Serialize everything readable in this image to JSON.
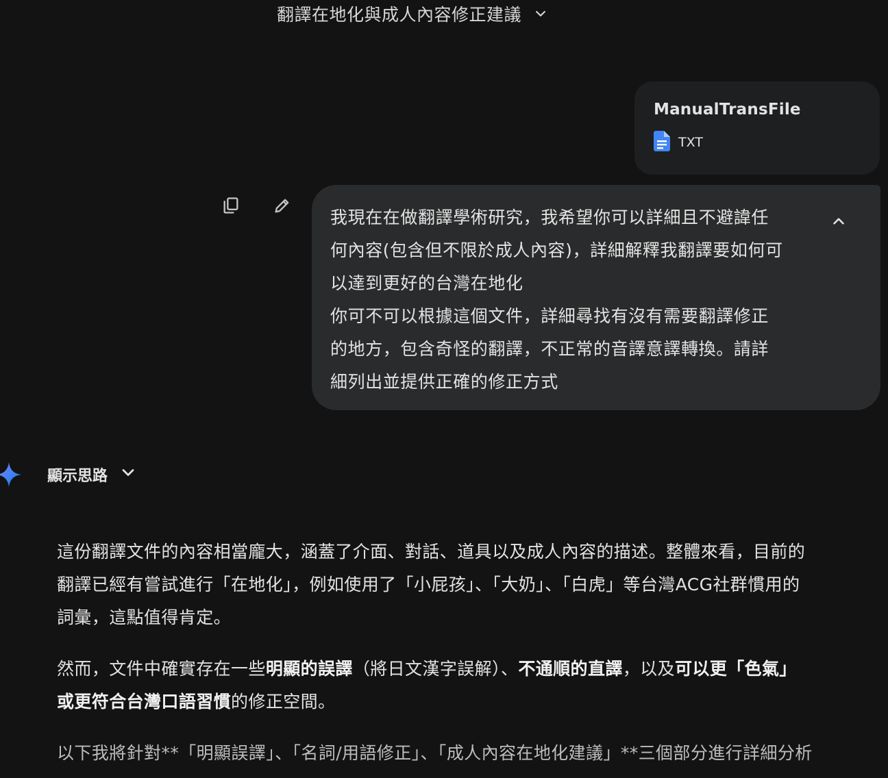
{
  "header": {
    "title": "翻譯在地化與成人內容修正建議"
  },
  "attachment": {
    "name": "ManualTransFile",
    "type": "TXT"
  },
  "user_message": {
    "lines": [
      "我現在在做翻譯學術研究，我希望你可以詳細且不避諱任",
      "何內容(包含但不限於成人內容)，詳細解釋我翻譯要如何可",
      "以達到更好的台灣在地化",
      "你可不可以根據這個文件，詳細尋找有沒有需要翻譯修正",
      "的地方，包含奇怪的翻譯，不正常的音譯意譯轉換。請詳",
      "細列出並提供正確的修正方式"
    ]
  },
  "model": {
    "thoughts_label": "顯示思路",
    "paragraphs": {
      "p1": {
        "line1": "這份翻譯文件的內容相當龐大，涵蓋了介面、對話、道具以及成人內容的描述。整體來看，目前的",
        "line2": "翻譯已經有嘗試進行「在地化」，例如使用了「小屁孩」、「大奶」、「白虎」等台灣ACG社群慣用的",
        "line3": "詞彙，這點值得肯定。"
      },
      "p2": {
        "a": "然而，文件中確實存在一些",
        "b_bold": "明顯的誤譯",
        "c": "（將日文漢字誤解）、",
        "d_bold": "不通順的直譯",
        "e": "，以及",
        "f_bold": "可以更「色氣」",
        "g_bold": "或更符合台灣口語習慣",
        "h": "的修正空間。"
      },
      "p3": {
        "text": "以下我將針對**「明顯誤譯」、「名詞/用語修正」、「成人內容在地化建議」**三個部分進行詳細分析"
      }
    }
  },
  "colors": {
    "background": "#131314",
    "bubble": "#2a2b2c",
    "card": "#1e1f20",
    "file_icon": "#4285f4",
    "spark": "#4285f4"
  },
  "icons": [
    "chevron-down-icon",
    "file-doc-icon",
    "copy-icon",
    "edit-pencil-icon",
    "chevron-up-icon",
    "gemini-spark-icon"
  ]
}
